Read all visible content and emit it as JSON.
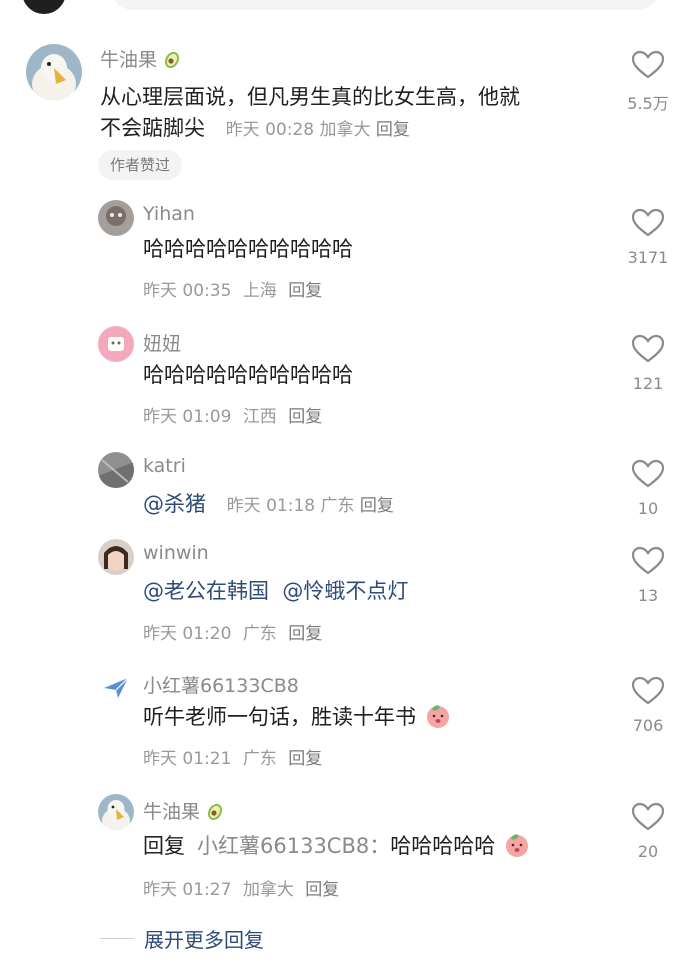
{
  "comments": [
    {
      "user": "牛油果",
      "text_lines": [
        "从心理层面说，但凡男生真的比女生高，他就",
        "不会踮脚尖"
      ],
      "time": "昨天 00:28",
      "location": "加拿大",
      "reply_label": "回复",
      "badge": "作者赞过",
      "likes": "5.5万"
    },
    {
      "user": "Yihan",
      "text": "哈哈哈哈哈哈哈哈哈哈",
      "time": "昨天 00:35",
      "location": "上海",
      "reply_label": "回复",
      "likes": "3171"
    },
    {
      "user": "妞妞",
      "text": "哈哈哈哈哈哈哈哈哈哈",
      "time": "昨天 01:09",
      "location": "江西",
      "reply_label": "回复",
      "likes": "121"
    },
    {
      "user": "katri",
      "text": "@杀猪",
      "time": "昨天 01:18",
      "location": "广东",
      "reply_label": "回复",
      "likes": "10"
    },
    {
      "user": "winwin",
      "mentions": [
        "@老公在韩国",
        "@怜蛾不点灯"
      ],
      "time": "昨天 01:20",
      "location": "广东",
      "reply_label": "回复",
      "likes": "13"
    },
    {
      "user": "小红薯66133CB8",
      "text": "听牛老师一句话，胜读十年书",
      "time": "昨天 01:21",
      "location": "广东",
      "reply_label": "回复",
      "likes": "706"
    },
    {
      "user": "牛油果",
      "reply_word": "回复",
      "reply_target": "小红薯66133CB8：",
      "text": "哈哈哈哈哈",
      "time": "昨天 01:27",
      "location": "加拿大",
      "reply_label": "回复",
      "likes": "20"
    }
  ],
  "expand_label": "展开更多回复",
  "icons": {
    "like": "heart-outline-icon",
    "name_badge": "avocado-icon",
    "emoji": "peach-face-icon"
  },
  "colors": {
    "mention": "#2f4b77",
    "meta": "#999999"
  }
}
